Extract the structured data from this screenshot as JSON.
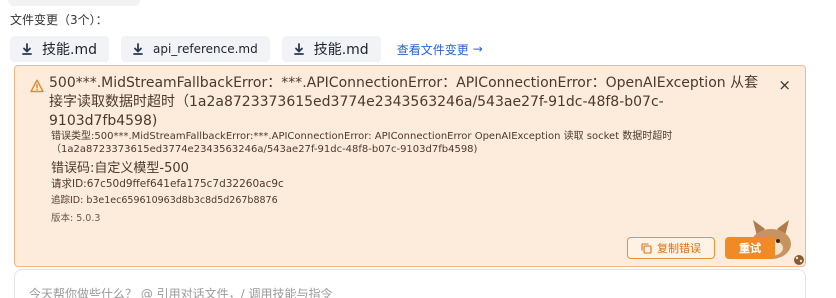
{
  "files": {
    "header": "文件变更（3个）：",
    "chips": [
      "技能.md",
      "api_reference.md",
      "技能.md"
    ],
    "view_changes_label": "查看文件变更",
    "view_changes_arrow": "→"
  },
  "error": {
    "title_line1": "500***.MidStreamFallbackError：***.APIConnectionError：APIConnectionError：OpenAIException 从套",
    "title_line2": "接字读取数据时超时（1a2a8723373615ed3774e2343563246a/543ae27f-91dc-48f8-b07c-9103d7fb4598)",
    "close": "×",
    "type_line1": "错误类型:500***.MidStreamFallbackError:***.APIConnectionError: APIConnectionError OpenAIException 读取 socket 数据时超时",
    "type_line2": "（1a2a8723373615ed3774e2343563246a/543ae27f-91dc-48f8-b07c-9103d7fb4598)",
    "code": "错误码:自定义模型-500",
    "request_id": "请求ID:67c50d9ffef641efa175c7d32260ac9c",
    "trace_id": "追踪ID: b3e1ec659610963d8b3c8d5d267b8876",
    "version": "版本: 5.0.3",
    "copy_label": "复制错误",
    "retry_label": "重试"
  },
  "input": {
    "placeholder": "今天帮你做些什么？ @ 引用对话文件，/ 调用技能与指令"
  },
  "colors": {
    "panel_bg": "#fdecdc",
    "panel_border": "#f3b889",
    "accent": "#f08a24",
    "link": "#2a62d6"
  }
}
